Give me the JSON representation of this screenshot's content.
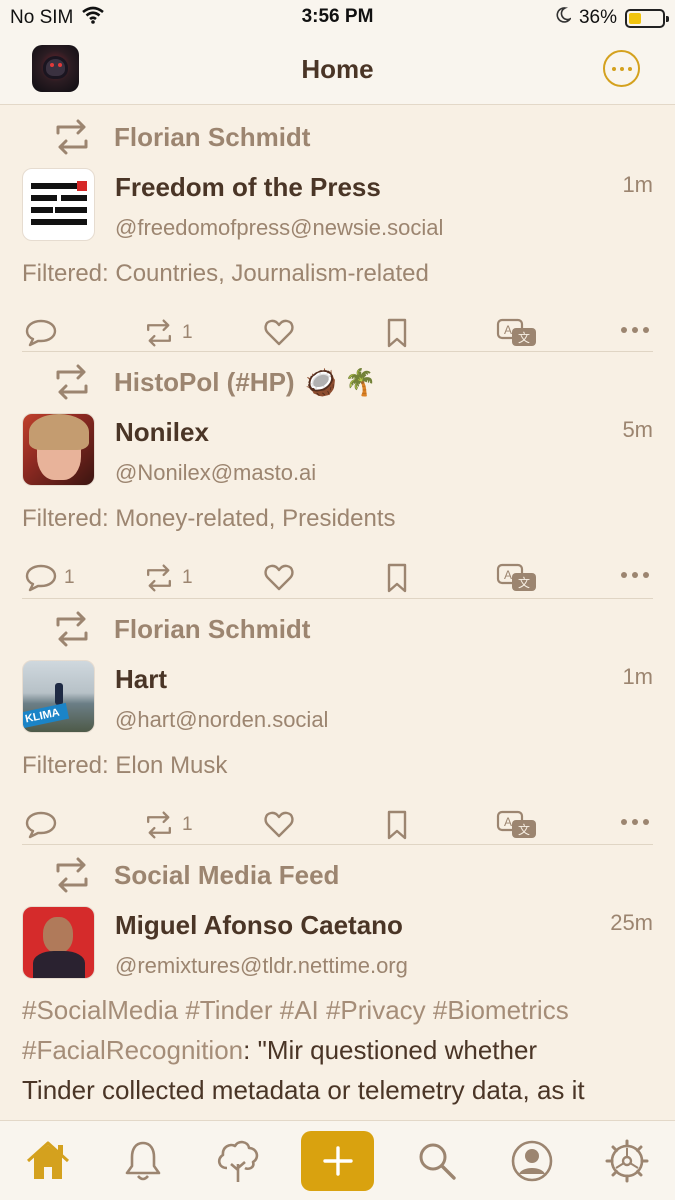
{
  "status_bar": {
    "carrier": "No SIM",
    "time": "3:56 PM",
    "battery_percent": "36%",
    "battery_level": 0.36
  },
  "nav": {
    "title": "Home"
  },
  "colors": {
    "accent": "#d4a11e",
    "background": "#f8f0e4",
    "muted_text": "#9c8570",
    "primary_text": "#4a3526"
  },
  "posts": [
    {
      "boosted_by": "Florian Schmidt",
      "boosted_by_emoji": "",
      "name": "Freedom of the Press",
      "handle": "@freedomofpress@newsie.social",
      "time": "1m",
      "filtered": "Filtered: Countries, Journalism-related",
      "reply_count": "",
      "boost_count": "1"
    },
    {
      "boosted_by": "HistoPol (#HP)",
      "boosted_by_emoji": "🥥 🌴",
      "name": "Nonilex",
      "handle": "@Nonilex@masto.ai",
      "time": "5m",
      "filtered": "Filtered: Money-related, Presidents",
      "reply_count": "1",
      "boost_count": "1"
    },
    {
      "boosted_by": "Florian Schmidt",
      "boosted_by_emoji": "",
      "name": "Hart",
      "handle": "@hart@norden.social",
      "time": "1m",
      "filtered": "Filtered: Elon Musk",
      "reply_count": "",
      "boost_count": "1",
      "avatar_text": "KLIMA"
    },
    {
      "boosted_by": "Social Media Feed",
      "boosted_by_emoji": "",
      "name": "Miguel Afonso Caetano",
      "handle": "@remixtures@tldr.nettime.org",
      "time": "25m",
      "hashtags_line1": "#SocialMedia #Tinder #AI #Privacy #Biometrics",
      "hashtags_line2": "#FacialRecognition",
      "text_line2_rest": ": \"Mir questioned whether",
      "text_line3": "Tinder collected metadata or telemetry data, as it"
    }
  ],
  "icons": {
    "status": [
      "wifi-icon",
      "moon-icon",
      "battery-icon"
    ],
    "nav": [
      "app-avatar",
      "more-options-icon"
    ],
    "post_actions": [
      "reply-icon",
      "boost-icon",
      "favorite-icon",
      "bookmark-icon",
      "translate-icon",
      "more-icon"
    ],
    "tabs": [
      "home-icon",
      "notifications-icon",
      "federated-tree-icon",
      "compose-plus-icon",
      "search-icon",
      "profile-icon",
      "settings-icon"
    ]
  }
}
